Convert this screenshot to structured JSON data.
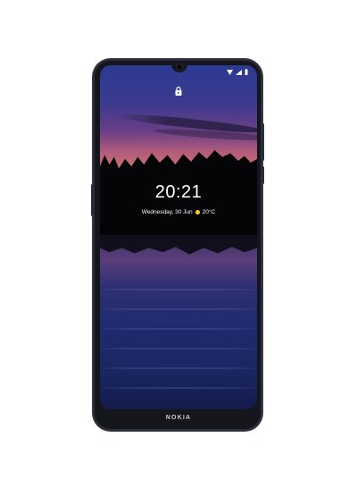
{
  "status_bar": {
    "icons": [
      "wifi-icon",
      "signal-icon",
      "battery-icon"
    ]
  },
  "lockscreen": {
    "lock_icon": "lock-icon",
    "time": "20:21",
    "date": "Wednesday, 30 Jun",
    "weather_icon": "sun-icon",
    "temperature": "20°C"
  },
  "device": {
    "brand": "NOKIA"
  },
  "colors": {
    "sky_top": "#2b3a92",
    "sky_bottom": "#c97a6e",
    "water": "#1f2a6e",
    "frame": "#15161c"
  }
}
